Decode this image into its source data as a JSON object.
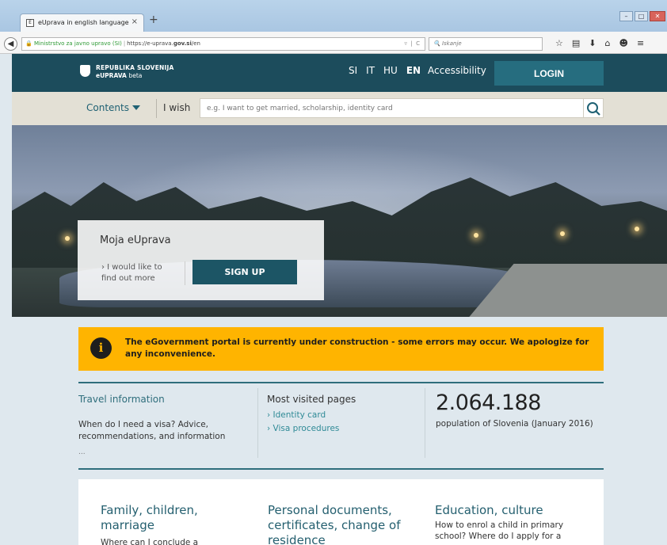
{
  "browser": {
    "tab_title": "eUprava in english language",
    "tab_close": "×",
    "new_tab": "+",
    "favicon": "E",
    "url_origin": "Ministrstvo za javno upravo (SI)",
    "url_prefix": "https://e-uprava.",
    "url_domain": "gov.si",
    "url_path": "/en",
    "search_placeholder": "Iskanje",
    "toolbar_icons": [
      "☆",
      "▤",
      "⬇",
      "⌂",
      "☻",
      "≡"
    ]
  },
  "header": {
    "logo_line1": "REPUBLIKA SLOVENIJA",
    "logo_line2": "eUPRAVA",
    "logo_beta": "beta",
    "languages": [
      "SI",
      "IT",
      "HU",
      "EN"
    ],
    "active_language": "EN",
    "accessibility": "Accessibility",
    "login": "LOGIN"
  },
  "search": {
    "contents": "Contents",
    "i_wish": "I wish",
    "placeholder": "e.g. I want to get married, scholarship, identity card"
  },
  "hero": {
    "title": "Moja eUprava",
    "find_out_more": "› I would like to find out more",
    "signup": "SIGN UP"
  },
  "notice": {
    "icon": "i",
    "text": "The eGovernment portal is currently under construction - some errors may occur. We apologize for any inconvenience."
  },
  "info": {
    "travel_title": "Travel information",
    "travel_body": "When do I need a visa? Advice, recommendations, and information",
    "travel_more": "...",
    "visited_title": "Most visited pages",
    "visited_links": [
      "› Identity card",
      "› Visa procedures"
    ],
    "population_number": "2.064.188",
    "population_caption": "population of Slovenia (January 2016)"
  },
  "cards": [
    {
      "title": "Family, children, marriage",
      "body": "Where can I conclude a"
    },
    {
      "title": "Personal documents, certificates, change of residence",
      "body": ""
    },
    {
      "title": "Education, culture",
      "body": "How to enrol a child in primary school? Where do I apply for a"
    }
  ],
  "colors": {
    "header_bg": "#1c4c5c",
    "login_bg": "#266d7f",
    "notice_bg": "#ffb400",
    "accent": "#2f6e7c"
  }
}
